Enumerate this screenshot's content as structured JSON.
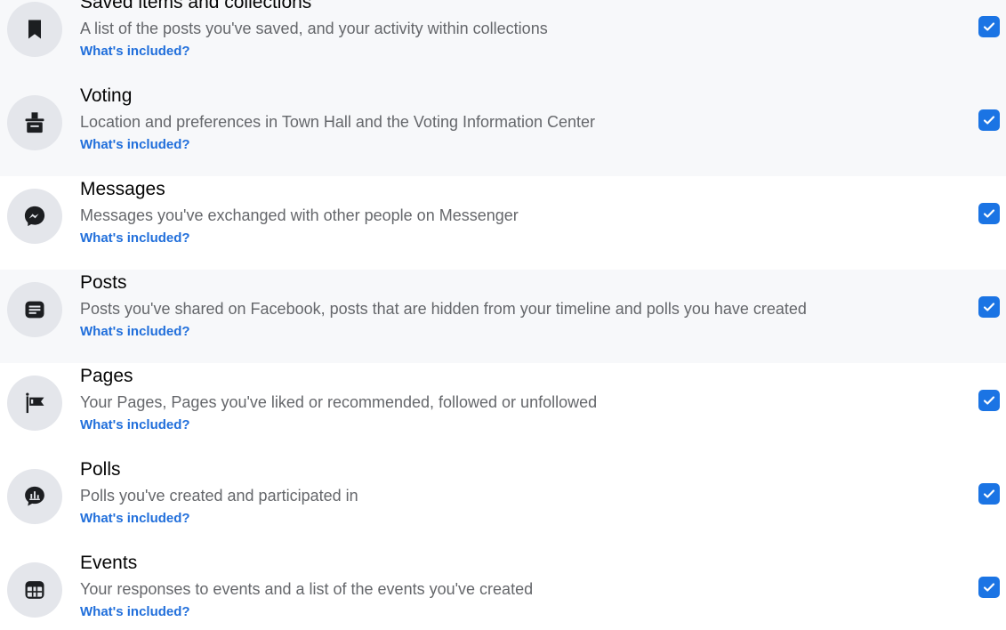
{
  "categories": [
    {
      "title": "Saved items and collections",
      "description": "A list of the posts you've saved, and your activity within collections",
      "link": "What's included?",
      "icon": "bookmark-icon",
      "checked": true
    },
    {
      "title": "Voting",
      "description": "Location and preferences in Town Hall and the Voting Information Center",
      "link": "What's included?",
      "icon": "ballot-box-icon",
      "checked": true
    },
    {
      "title": "Messages",
      "description": "Messages you've exchanged with other people on Messenger",
      "link": "What's included?",
      "icon": "messenger-icon",
      "checked": true
    },
    {
      "title": "Posts",
      "description": "Posts you've shared on Facebook, posts that are hidden from your timeline and polls you have created",
      "link": "What's included?",
      "icon": "post-icon",
      "checked": true
    },
    {
      "title": "Pages",
      "description": "Your Pages, Pages you've liked or recommended, followed or unfollowed",
      "link": "What's included?",
      "icon": "flag-icon",
      "checked": true
    },
    {
      "title": "Polls",
      "description": "Polls you've created and participated in",
      "link": "What's included?",
      "icon": "poll-icon",
      "checked": true
    },
    {
      "title": "Events",
      "description": "Your responses to events and a list of the events you've created",
      "link": "What's included?",
      "icon": "calendar-icon",
      "checked": true
    }
  ],
  "colors": {
    "accent": "#1b74e4",
    "link": "#216fdb",
    "icon_bg": "#e4e6eb",
    "row_shaded": "#f7f8fa"
  }
}
